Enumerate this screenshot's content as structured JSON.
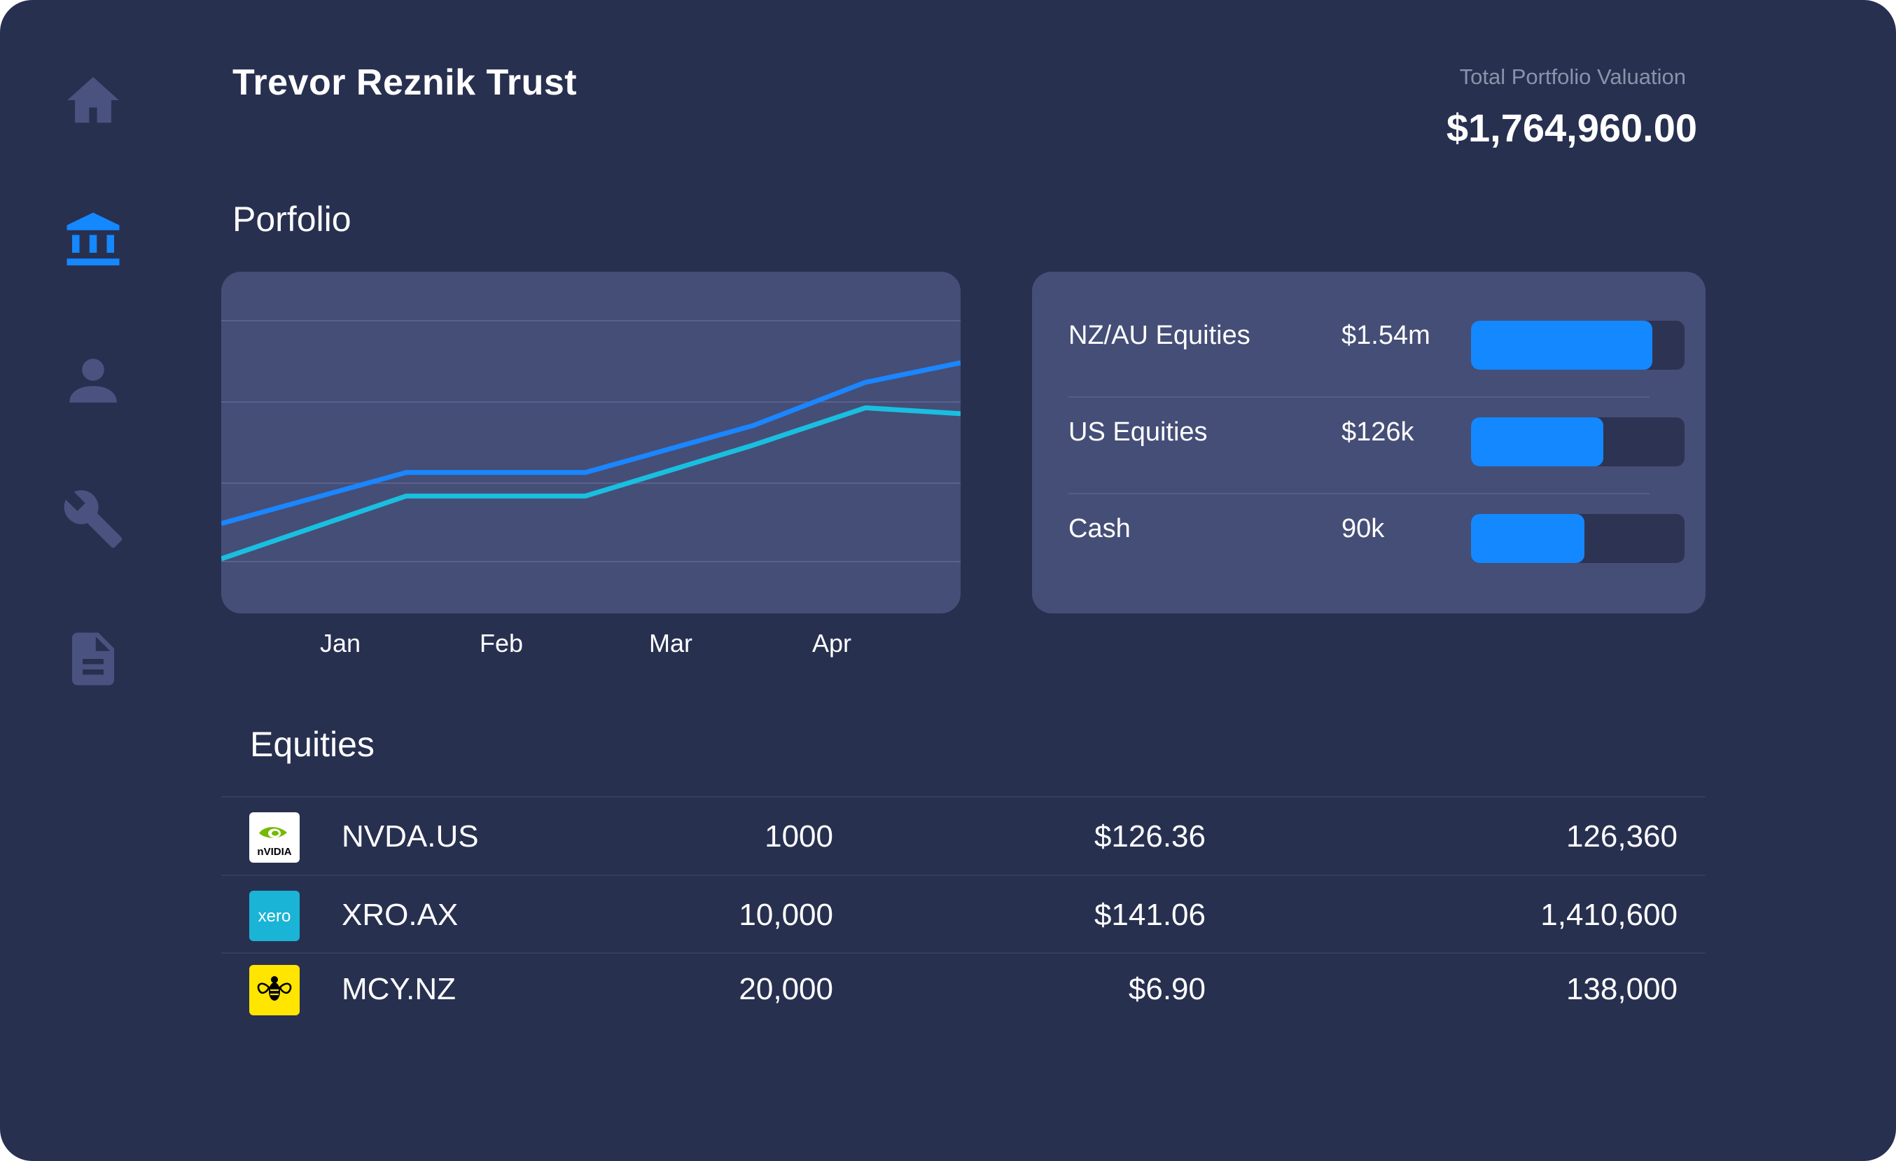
{
  "header": {
    "title": "Trevor Reznik Trust",
    "valuation_label": "Total Portfolio Valuation",
    "valuation_value": "$1,764,960.00"
  },
  "sidebar": {
    "items": [
      {
        "icon": "home-icon",
        "active": false
      },
      {
        "icon": "bank-icon",
        "active": true
      },
      {
        "icon": "person-icon",
        "active": false
      },
      {
        "icon": "wrench-icon",
        "active": false
      },
      {
        "icon": "document-icon",
        "active": false
      }
    ]
  },
  "portfolio": {
    "title": "Porfolio",
    "chart_data": {
      "type": "line",
      "categories": [
        "Jan",
        "Feb",
        "Mar",
        "Apr"
      ],
      "series": [
        {
          "color": "#1a86ff",
          "values": [
            0.18,
            0.44,
            0.44,
            0.68,
            0.9,
            1.0
          ]
        },
        {
          "color": "#19bfe0",
          "values": [
            0.0,
            0.32,
            0.32,
            0.58,
            0.77,
            0.74
          ]
        }
      ],
      "ylim": [
        0,
        1
      ],
      "grid": true
    },
    "allocations": [
      {
        "name": "NZ/AU Equities",
        "value": "$1.54m",
        "fraction": 0.85
      },
      {
        "name": "US Equities",
        "value": "$126k",
        "fraction": 0.62
      },
      {
        "name": "Cash",
        "value": "90k",
        "fraction": 0.53
      }
    ],
    "colors": {
      "accent": "#1488ff",
      "background": "#283050",
      "card": "#454e76"
    }
  },
  "equities": {
    "title": "Equities",
    "rows": [
      {
        "logo": "nvidia-logo",
        "symbol": "NVDA.US",
        "quantity": "1000",
        "price": "$126.36",
        "total": "126,360"
      },
      {
        "logo": "xero-logo",
        "symbol": "XRO.AX",
        "quantity": "10,000",
        "price": "$141.06",
        "total": "1,410,600"
      },
      {
        "logo": "mercury-logo",
        "symbol": "MCY.NZ",
        "quantity": "20,000",
        "price": "$6.90",
        "total": "138,000"
      }
    ]
  },
  "logos": {
    "nvidia_text": "nVIDIA",
    "xero_text": "xero"
  }
}
